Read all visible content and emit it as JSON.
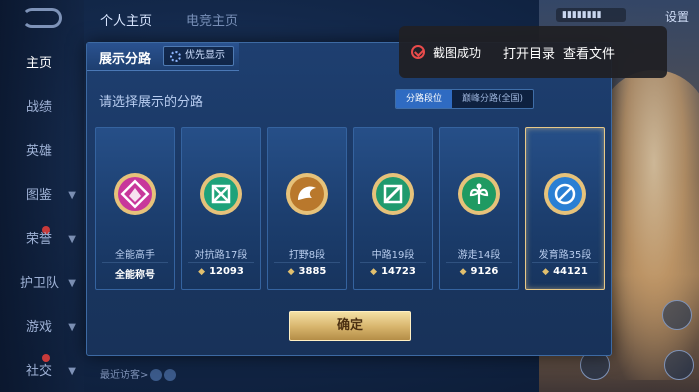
{
  "top_tabs": [
    "个人主页",
    "电竞主页"
  ],
  "settings_label": "设置",
  "sidebar": {
    "items": [
      {
        "label": "主页"
      },
      {
        "label": "战绩"
      },
      {
        "label": "英雄"
      },
      {
        "label": "图鉴"
      },
      {
        "label": "荣誉"
      },
      {
        "label": "护卫队"
      },
      {
        "label": "游戏"
      },
      {
        "label": "社交"
      }
    ]
  },
  "recent_visitors": "最近访客>",
  "dialog": {
    "title": "展示分路",
    "priority_button": "优先显示",
    "prompt": "请选择展示的分路",
    "segments": [
      {
        "label": "分路段位",
        "active": true
      },
      {
        "label": "巅峰分路(全国)",
        "active": false
      }
    ],
    "cards": [
      {
        "name": "全能高手",
        "value": "全能称号",
        "badge_color": "#c8379b",
        "selected": false
      },
      {
        "name": "对抗路17段",
        "value": "12093",
        "badge_color": "#1fa27a",
        "selected": false
      },
      {
        "name": "打野8段",
        "value": "3885",
        "badge_color": "#b9782c",
        "selected": false
      },
      {
        "name": "中路19段",
        "value": "14723",
        "badge_color": "#1f9a6e",
        "selected": false
      },
      {
        "name": "游走14段",
        "value": "9126",
        "badge_color": "#1f9a62",
        "selected": false
      },
      {
        "name": "发育路35段",
        "value": "44121",
        "badge_color": "#2a7fd4",
        "selected": true
      }
    ],
    "confirm_label": "确定"
  },
  "toast": {
    "message": "截图成功",
    "open_dir": "打开目录",
    "view_file": "查看文件"
  }
}
